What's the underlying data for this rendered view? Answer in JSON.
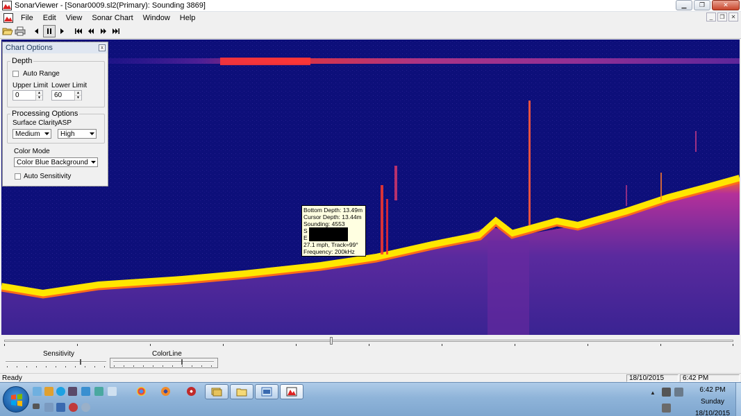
{
  "window": {
    "title": "SonarViewer - [Sonar0009.sl2(Primary): Sounding 3869]"
  },
  "menu": {
    "items": [
      "File",
      "Edit",
      "View",
      "Sonar Chart",
      "Window",
      "Help"
    ]
  },
  "toolbar": {
    "icons": [
      "open-icon",
      "print-icon",
      "step-back-icon",
      "pause-icon",
      "play-icon",
      "skip-start-icon",
      "rewind-icon",
      "fast-forward-icon",
      "skip-end-icon"
    ]
  },
  "chart_options": {
    "title": "Chart Options",
    "depth": {
      "label": "Depth",
      "auto_range": "Auto Range",
      "upper_limit_label": "Upper Limit",
      "lower_limit_label": "Lower Limit",
      "upper_limit": "0",
      "lower_limit": "60"
    },
    "processing": {
      "label": "Processing Options",
      "surface_clarity_label": "Surface Clarity",
      "asp_label": "ASP",
      "surface_clarity": "Medium",
      "asp": "High"
    },
    "color_mode_label": "Color Mode",
    "color_mode": "Color Blue Background",
    "auto_sensitivity": "Auto Sensitivity"
  },
  "tooltip": {
    "bottom_depth": "Bottom Depth: 13.49m",
    "cursor_depth": "Cursor Depth: 13.44m",
    "sounding": "Sounding: 4553",
    "s_label": "S",
    "e_label": "E",
    "speed": "27.1 mph, Track=99°",
    "frequency": "Frequency: 200kHz"
  },
  "controls": {
    "sensitivity_label": "Sensitivity",
    "colorline_label": "ColorLine"
  },
  "status": {
    "text": "Ready",
    "date": "18/10/2015",
    "time": "6:42 PM"
  },
  "taskbar": {
    "clock_time": "6:42 PM",
    "clock_day": "Sunday",
    "clock_date": "18/10/2015"
  },
  "colors": {
    "sonar_background": "#0d0f7a",
    "bottom_return": "#ffe600",
    "return_red": "#ff2a2a",
    "return_magenta": "#c43aa0"
  }
}
